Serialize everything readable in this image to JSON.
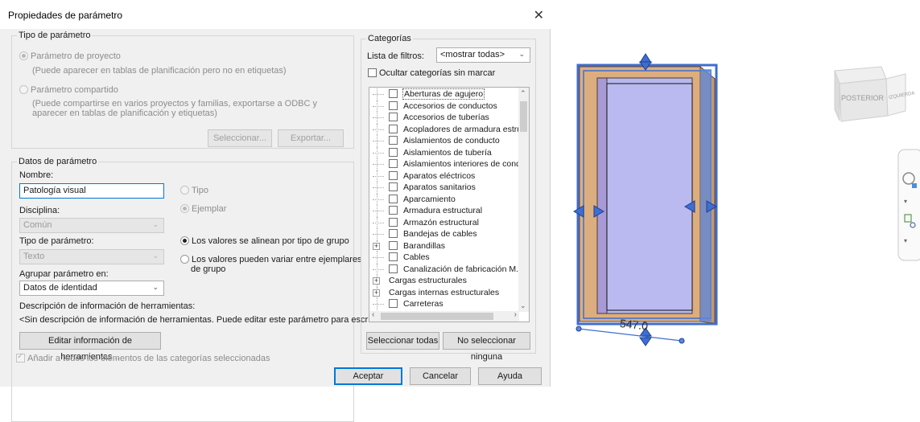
{
  "dialog": {
    "title": "Propiedades de parámetro",
    "close_glyph": "✕"
  },
  "tipo_parametro": {
    "legend": "Tipo de parámetro",
    "proyecto_label": "Parámetro de proyecto",
    "proyecto_desc": "(Puede aparecer en tablas de planificación pero no en etiquetas)",
    "compartido_label": "Parámetro compartido",
    "compartido_desc1": "(Puede compartirse en varios proyectos y familias, exportarse a ODBC y",
    "compartido_desc2": "aparecer en tablas de planificación y etiquetas)",
    "seleccionar_btn": "Seleccionar...",
    "exportar_btn": "Exportar..."
  },
  "datos_parametro": {
    "legend": "Datos de parámetro",
    "nombre_label": "Nombre:",
    "nombre_value": "Patología visual",
    "tipo_radio": "Tipo",
    "ejemplar_radio": "Ejemplar",
    "disciplina_label": "Disciplina:",
    "disciplina_value": "Común",
    "tipo_param_label": "Tipo de parámetro:",
    "tipo_param_value": "Texto",
    "alinean_radio": "Los valores se alinean por tipo de grupo",
    "variar_radio_1": "Los valores pueden variar entre ejemplares",
    "variar_radio_2": "de grupo",
    "agrupar_label": "Agrupar parámetro en:",
    "agrupar_value": "Datos de identidad",
    "descripcion_label": "Descripción de información de herramientas:",
    "descripcion_value": "<Sin descripción de información de herramientas. Puede editar este parámetro para escri...",
    "editar_btn": "Editar información de herramientas..."
  },
  "categorias": {
    "legend": "Categorías",
    "filtro_label": "Lista de filtros:",
    "filtro_value": "<mostrar todas>",
    "ocultar_label": "Ocultar categorías sin marcar",
    "items": [
      "Aberturas de agujero",
      "Accesorios de conductos",
      "Accesorios de tuberías",
      "Acopladores de armadura estruct",
      "Aislamientos de conducto",
      "Aislamientos de tubería",
      "Aislamientos interiores de condu...",
      "Aparatos eléctricos",
      "Aparatos sanitarios",
      "Aparcamiento",
      "Armadura estructural",
      "Armazón estructural",
      "Bandejas de cables",
      "Barandillas",
      "Cables",
      "Canalización de fabricación M...",
      "Cargas estructurales",
      "Cargas internas estructurales",
      "Carreteras"
    ],
    "seleccionar_todas_btn": "Seleccionar todas",
    "no_seleccionar_btn": "No seleccionar ninguna"
  },
  "footer": {
    "anadir_label": "Añadir a todos los elementos de las categorías seleccionadas",
    "aceptar_btn": "Aceptar",
    "cancelar_btn": "Cancelar",
    "ayuda_btn": "Ayuda"
  },
  "model_view": {
    "dimension_text": "547.0",
    "viewcube_face_label": "POSTERIOR",
    "viewcube_side_label": "IZQUIERDA"
  },
  "colors": {
    "frame_wood": "#dcae7f",
    "glass": "#b8b8ee",
    "selection_blue": "#3f6ed1",
    "accent": "#0078d7"
  }
}
